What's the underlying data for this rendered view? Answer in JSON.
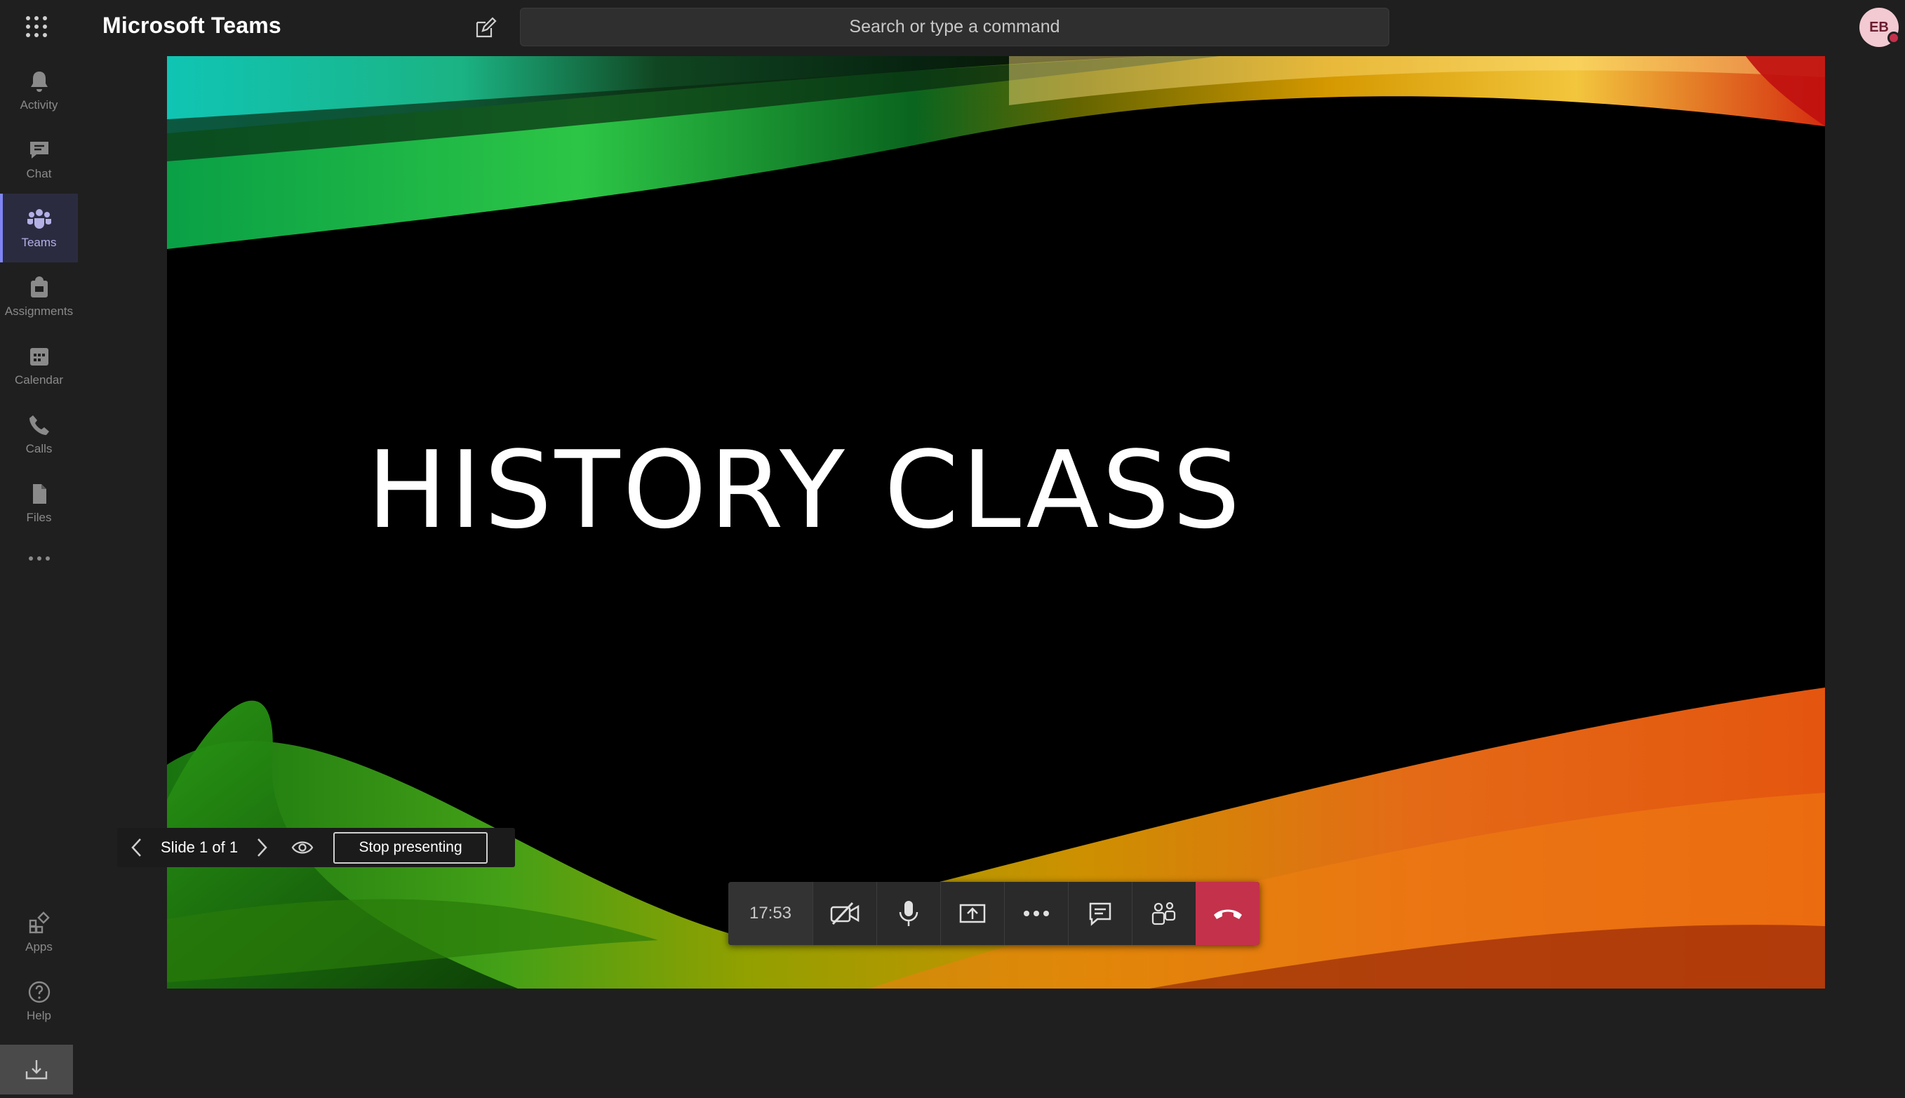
{
  "app": {
    "title": "Microsoft Teams"
  },
  "search": {
    "placeholder": "Search or type a command"
  },
  "user": {
    "initials": "EB",
    "presence_color": "#c4314b"
  },
  "rail": {
    "items": [
      {
        "label": "Activity",
        "icon": "bell-icon"
      },
      {
        "label": "Chat",
        "icon": "chat-icon"
      },
      {
        "label": "Teams",
        "icon": "teams-icon",
        "active": true
      },
      {
        "label": "Assignments",
        "icon": "assignments-icon"
      },
      {
        "label": "Calendar",
        "icon": "calendar-icon"
      },
      {
        "label": "Calls",
        "icon": "phone-icon"
      },
      {
        "label": "Files",
        "icon": "files-icon"
      }
    ],
    "more_icon": "more-horizontal-icon",
    "bottom_items": [
      {
        "label": "Apps",
        "icon": "apps-icon"
      },
      {
        "label": "Help",
        "icon": "help-icon"
      }
    ],
    "install_icon": "download-icon"
  },
  "slide": {
    "title": "HISTORY CLASS"
  },
  "presenter_bar": {
    "slide_counter": "Slide 1 of 1",
    "stop_label": "Stop presenting"
  },
  "call_controls": {
    "timer": "17:53",
    "buttons": [
      "camera-off-icon",
      "microphone-icon",
      "share-screen-icon",
      "more-options-icon",
      "show-conversation-icon",
      "show-participants-icon",
      "hang-up-icon"
    ]
  },
  "colors": {
    "accent": "#7f85f5",
    "hangup": "#c4314b",
    "background": "#1f1f1f"
  }
}
